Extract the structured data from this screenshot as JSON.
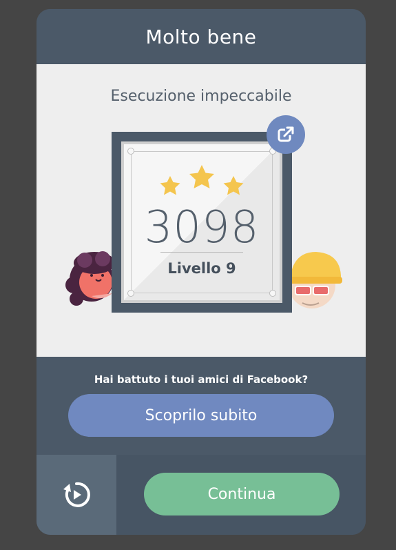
{
  "header": {
    "title": "Molto bene"
  },
  "result": {
    "subtitle": "Esecuzione impeccabile",
    "stars": 3,
    "score": "3098",
    "level": "Livello 9"
  },
  "icons": {
    "share": "share-icon",
    "replay": "replay-icon",
    "star": "star-icon"
  },
  "facebook": {
    "question": "Hai battuto i tuoi amici di Facebook?",
    "button_label": "Scoprilo subito"
  },
  "footer": {
    "continue_label": "Continua"
  },
  "colors": {
    "dark_slate": "#4b5968",
    "panel_light": "#eeeeee",
    "fb_blue": "#7089c0",
    "continue_green": "#77bf96",
    "star_gold": "#f4c54e"
  }
}
